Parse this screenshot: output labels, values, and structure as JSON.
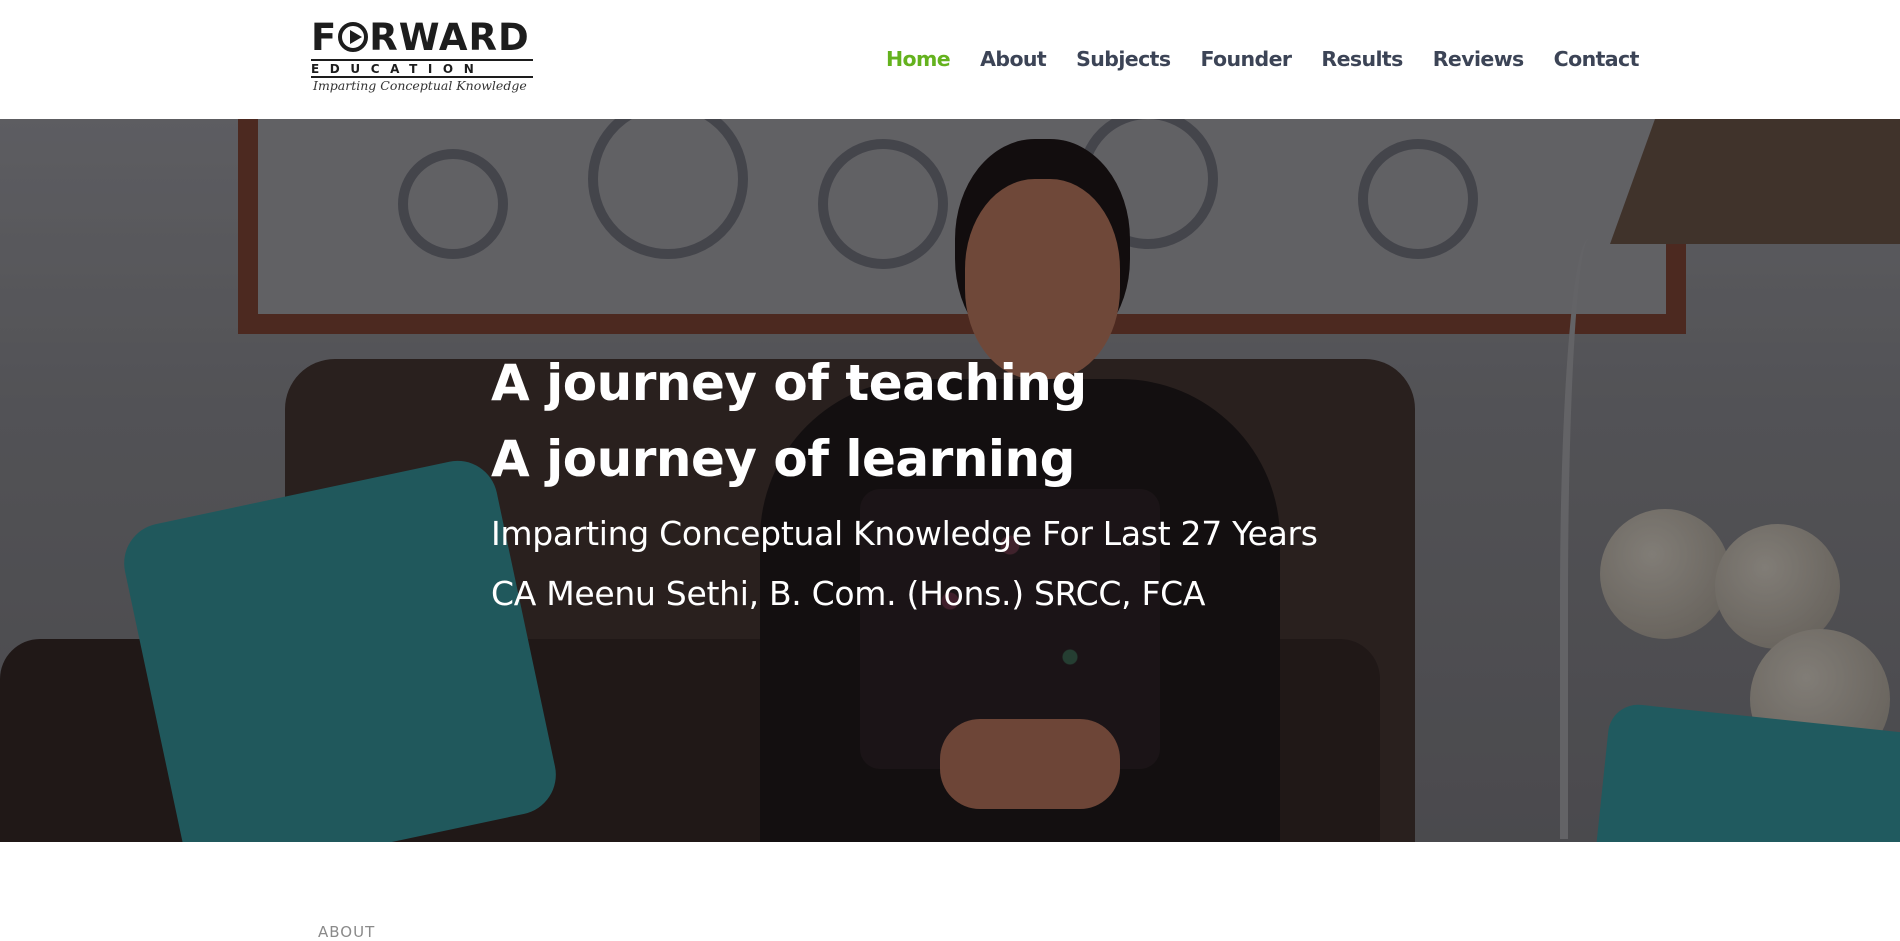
{
  "header": {
    "logo": {
      "wordmark": "FORWARD",
      "subtitle": "EDUCATION",
      "tagline": "Imparting Conceptual Knowledge"
    },
    "nav": [
      {
        "label": "Home",
        "active": true
      },
      {
        "label": "About",
        "active": false
      },
      {
        "label": "Subjects",
        "active": false
      },
      {
        "label": "Founder",
        "active": false
      },
      {
        "label": "Results",
        "active": false
      },
      {
        "label": "Reviews",
        "active": false
      },
      {
        "label": "Contact",
        "active": false
      }
    ]
  },
  "hero": {
    "title_line1": "A journey of teaching",
    "title_line2": "A journey of learning",
    "subtitle": "Imparting Conceptual Knowledge For Last 27 Years",
    "credentials": "CA Meenu Sethi, B. Com. (Hons.) SRCC, FCA"
  },
  "next_section": {
    "label": "ABOUT"
  },
  "colors": {
    "nav_active": "#64b21e",
    "nav_default": "#3c4456",
    "hero_text": "#ffffff"
  }
}
